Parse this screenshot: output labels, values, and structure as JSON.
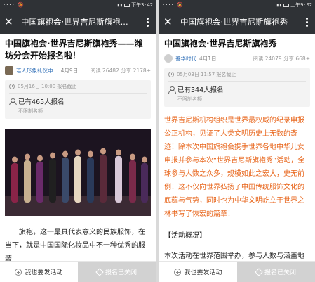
{
  "left": {
    "status": {
      "left": "···· 🔕",
      "right": "下午3:42"
    },
    "titlebar": {
      "title": "中国旗袍会·世界吉尼斯旗袍..."
    },
    "headline": "中国旗袍会·世界吉尼斯旗袍秀——潍坊分会开始报名啦！",
    "meta": {
      "author": "若人形象礼仪中...",
      "date": "4月9日",
      "stats": "阅读 26482 分享 2178+"
    },
    "registration": {
      "deadline": "05月16日 10:00 报名截止",
      "count": "已有465人报名",
      "limit": "不限制名额"
    },
    "body": "旗袍，这一最具代表意义的民族服饰，在当下，就是中国国际化妆品中不一种优秀的服装",
    "footer": {
      "launch": "我也要发活动",
      "closed": "报名已关闭"
    }
  },
  "right": {
    "status": {
      "left": "···· 🔕",
      "right": "上午9:02"
    },
    "titlebar": {
      "title": "中国旗袍会·世界吉尼斯旗袍秀"
    },
    "headline": "中国旗袍会·世界吉尼斯旗袍秀",
    "meta": {
      "author": "善华时代",
      "date": "4月1日",
      "stats": "阅读 24079 分享 668+"
    },
    "registration": {
      "deadline": "05月03日 11:57 报名截止",
      "count": "已有344人报名",
      "limit": "不限制名额"
    },
    "intro": "世界吉尼斯机构组织是世界最权威的纪录申报公正机构，见证了人类文明历史上无数的奇迹！除本次中国旗袍会携手世界各地中华儿女申报并参与本次“世界吉尼斯旗袍秀”活动，全球参与人数之众多，规模如此之宏大，史无前例！这不仅向世界弘扬了中国传统服饰文化的底蕴与气势，同时也为中华文明屹立于世界之林书写了恢宏的篇章！",
    "section_title": "【活动概况】",
    "body": "本次活动在世界范围举办，参与人数与涵盖地区",
    "footer": {
      "launch": "我也要发活动",
      "closed": "报名已关闭"
    }
  },
  "colors": {
    "titlebar": "#2f3236",
    "accent_text": "#e8661c",
    "link": "#2a6bb5"
  }
}
